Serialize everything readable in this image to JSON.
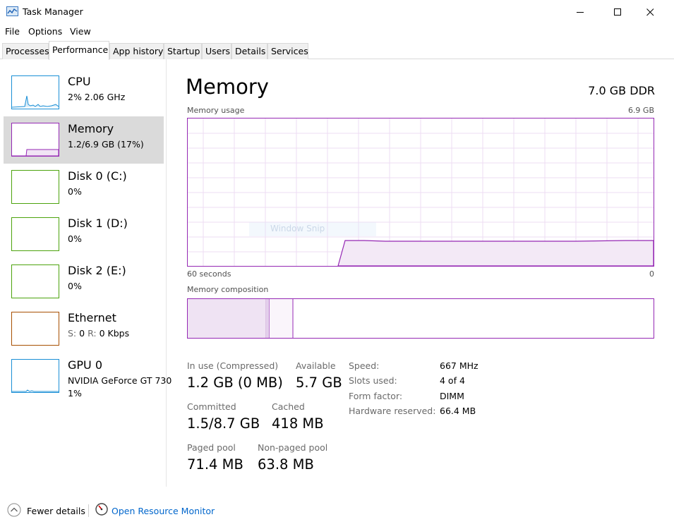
{
  "window": {
    "title": "Task Manager",
    "controls": [
      "minimize-icon",
      "maximize-icon",
      "close-icon"
    ]
  },
  "menu": [
    "File",
    "Options",
    "View"
  ],
  "tabs": [
    "Processes",
    "Performance",
    "App history",
    "Startup",
    "Users",
    "Details",
    "Services"
  ],
  "active_tab": "Performance",
  "sidebar": {
    "items": [
      {
        "name": "CPU",
        "sub": "2%  2.06 GHz",
        "sub2": "",
        "color": "#1a8fd6"
      },
      {
        "name": "Memory",
        "sub": "1.2/6.9 GB (17%)",
        "sub2": "",
        "color": "#9528b4"
      },
      {
        "name": "Disk 0 (C:)",
        "sub": "0%",
        "sub2": "",
        "color": "#4ca30d"
      },
      {
        "name": "Disk 1 (D:)",
        "sub": "0%",
        "sub2": "",
        "color": "#4ca30d"
      },
      {
        "name": "Disk 2 (E:)",
        "sub": "0%",
        "sub2": "",
        "color": "#4ca30d"
      },
      {
        "name": "Ethernet",
        "sub_s_label": "S:",
        "sub_s_value": "0",
        "sub_r_label": "R:",
        "sub_r_value": "0 Kbps",
        "sub2": "",
        "color": "#a74f01"
      },
      {
        "name": "GPU 0",
        "sub": "NVIDIA GeForce GT 730",
        "sub2": "1%",
        "color": "#1a8fd6"
      }
    ],
    "selected": "Memory"
  },
  "main": {
    "title": "Memory",
    "model": "7.0 GB DDR",
    "usage_label": "Memory usage",
    "usage_max": "6.9 GB",
    "time_left": "60 seconds",
    "time_right": "0",
    "composition_label": "Memory composition",
    "watermark": "Window Snip"
  },
  "stats": {
    "in_use_label": "In use (Compressed)",
    "in_use_value": "1.2 GB (0 MB)",
    "available_label": "Available",
    "available_value": "5.7 GB",
    "committed_label": "Committed",
    "committed_value": "1.5/8.7 GB",
    "cached_label": "Cached",
    "cached_value": "418 MB",
    "paged_label": "Paged pool",
    "paged_value": "71.4 MB",
    "nonpaged_label": "Non-paged pool",
    "nonpaged_value": "63.8 MB"
  },
  "details": [
    {
      "label": "Speed:",
      "value": "667 MHz"
    },
    {
      "label": "Slots used:",
      "value": "4 of 4"
    },
    {
      "label": "Form factor:",
      "value": "DIMM"
    },
    {
      "label": "Hardware reserved:",
      "value": "66.4 MB"
    }
  ],
  "footer": {
    "fewer_details": "Fewer details",
    "open_resource_monitor": "Open Resource Monitor"
  },
  "colors": {
    "memory": "#9528b4",
    "link": "#0066cc"
  }
}
